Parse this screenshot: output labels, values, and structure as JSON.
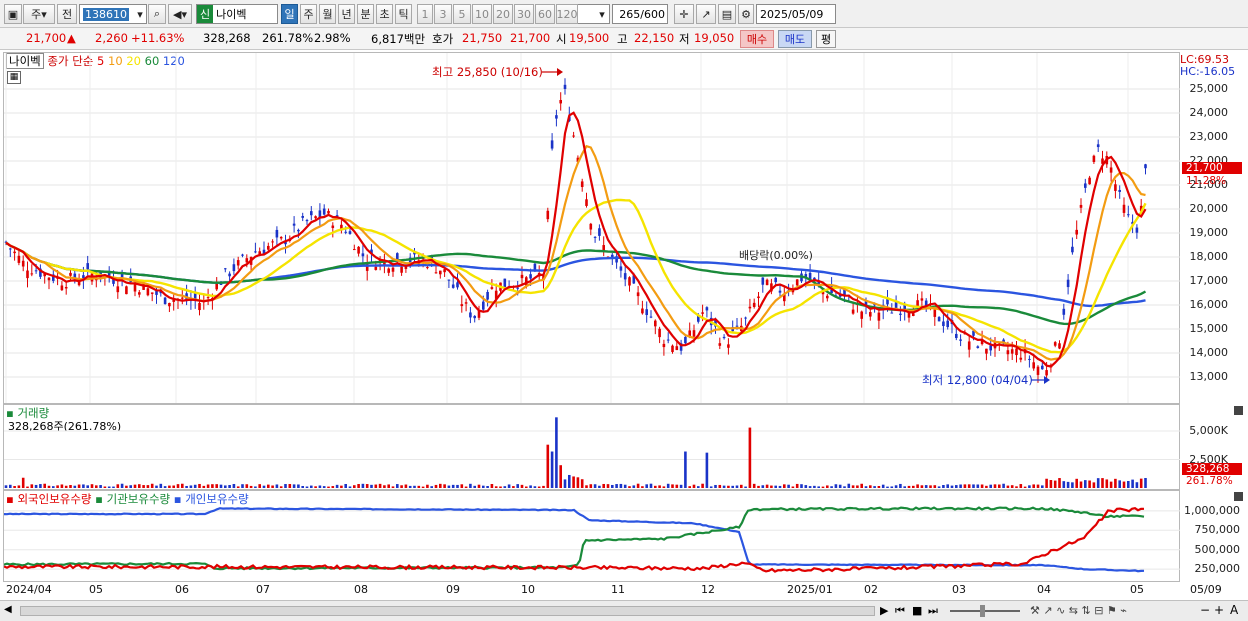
{
  "toolbar": {
    "chart_type": "주",
    "prev_label": "전",
    "code": "138610",
    "market_tag": "신",
    "stock_name": "나이벡",
    "periods": [
      "일",
      "주",
      "월",
      "년",
      "분",
      "초",
      "틱"
    ],
    "active_period": "일",
    "intervals": [
      "1",
      "3",
      "5",
      "10",
      "20",
      "30",
      "60",
      "120"
    ],
    "count": "265",
    "count_max": "/600",
    "date": "2025/05/09"
  },
  "quote": {
    "price": "21,700",
    "arrow": "▲",
    "change": "2,260",
    "change_pct": "+11.63%",
    "volume": "328,268",
    "volume_ratio": "261.78%",
    "turnover": "2.98%",
    "amount": "6,817백만",
    "bid_label": "호가",
    "bid1": "21,750",
    "bid2": "21,700",
    "open_label": "시",
    "open": "19,500",
    "high_label": "고",
    "high": "22,150",
    "low_label": "저",
    "low": "19,050",
    "buy": "매수",
    "sell": "매도",
    "avg": "평"
  },
  "price_pane": {
    "name_tag": "나이벡",
    "ma_label": "종가 단순",
    "ma_periods": [
      "5",
      "10",
      "20",
      "60",
      "120"
    ],
    "ma_colors": [
      "#e00000",
      "#f39c12",
      "#f5e400",
      "#1a8a3a",
      "#2b55e0"
    ],
    "lc": "LC:69.53",
    "hc": "HC:-16.05",
    "current_price_tag": "21,700",
    "current_pct_tag": "11.28%",
    "high_note": "최고 25,850 (10/16)",
    "low_note": "최저 12,800 (04/04)",
    "dividend_note": "배당락(0.00%)",
    "y_ticks": [
      "25,000",
      "24,000",
      "23,000",
      "22,000",
      "21,000",
      "20,000",
      "19,000",
      "18,000",
      "17,000",
      "16,000",
      "15,000",
      "14,000",
      "13,000"
    ]
  },
  "volume_pane": {
    "title": "거래량",
    "subtitle": "328,268주(261.78%)",
    "y_ticks": [
      "5,000K",
      "2,500K"
    ],
    "current_tag": "328,268",
    "current_pct": "261.78%"
  },
  "holding_pane": {
    "legend": [
      "외국인보유수량",
      "기관보유수량",
      "개인보유수량"
    ],
    "colors": [
      "#e00000",
      "#1a8a3a",
      "#2b55e0"
    ],
    "y_ticks": [
      "1,000,000",
      "750,000",
      "500,000",
      "250,000"
    ]
  },
  "x_axis": [
    "2024/04",
    "05",
    "06",
    "07",
    "08",
    "09",
    "10",
    "11",
    "12",
    "2025/01",
    "02",
    "03",
    "04",
    "05",
    "05/09"
  ],
  "chart_data": {
    "type": "line",
    "title": "",
    "x": [
      "2024/04",
      "05",
      "06",
      "07",
      "08",
      "09",
      "10",
      "11",
      "12",
      "2025/01",
      "02",
      "03",
      "04",
      "05"
    ],
    "close_approx": [
      17600,
      17200,
      16200,
      18500,
      18000,
      17200,
      17000,
      17500,
      14200,
      17000,
      16000,
      14300,
      13200,
      21700
    ],
    "ylim": [
      12500,
      25850
    ],
    "series": [
      {
        "name": "5",
        "values": [
          17600,
          17300,
          16100,
          18900,
          18200,
          15400,
          24500,
          18100,
          13900,
          17200,
          15800,
          14200,
          13100,
          20000
        ]
      },
      {
        "name": "120",
        "values": [
          18200,
          18400,
          18200,
          17800,
          17700,
          17900,
          18100,
          17800,
          17700,
          17400,
          16900,
          16600,
          16300,
          16300
        ]
      }
    ],
    "annotations": [
      "최고 25,850 (10/16)",
      "최저 12,800 (04/04)",
      "배당락(0.00%)"
    ]
  }
}
